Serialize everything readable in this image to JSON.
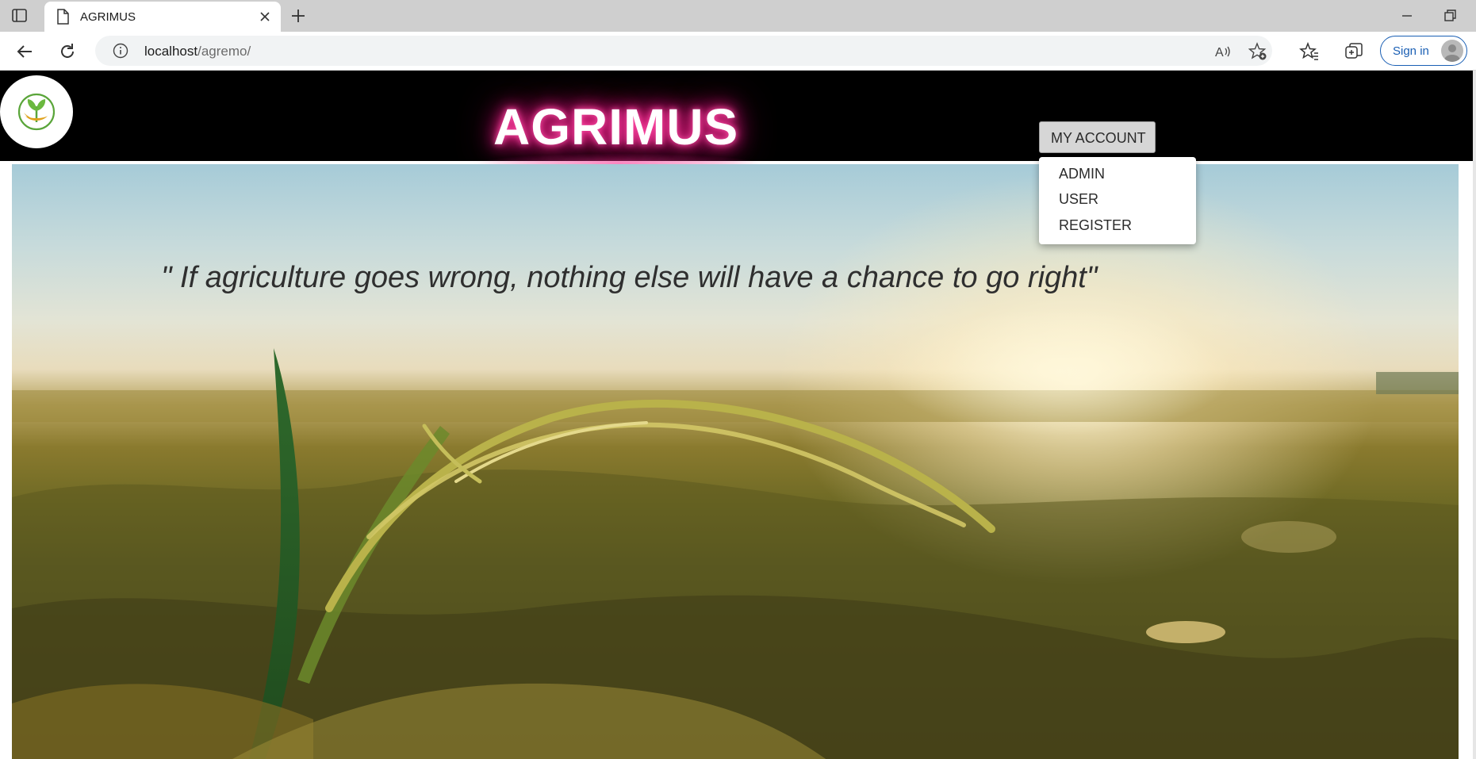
{
  "browser": {
    "tab_title": "AGRIMUS",
    "url_host": "localhost",
    "url_path": "/agremo/",
    "signin_label": "Sign in"
  },
  "site": {
    "brand": "AGRIMUS",
    "account_button": "MY ACCOUNT",
    "account_menu": [
      "ADMIN",
      "USER",
      "REGISTER"
    ],
    "quote": "\" If agriculture goes wrong, nothing else will have a chance to go right\"",
    "colors": {
      "header_bg": "#000000",
      "brand_glow": "#ff2d95",
      "logo_green": "#5aa53a",
      "logo_gold": "#e0a21c"
    }
  }
}
